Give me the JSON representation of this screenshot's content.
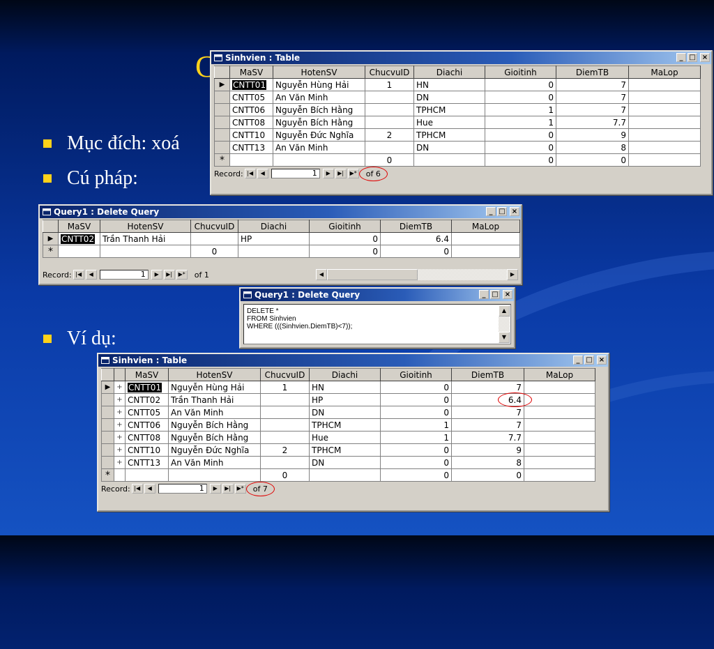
{
  "slide": {
    "title_fragment": "C",
    "bullets": [
      {
        "text": "Mục đích: xoá"
      },
      {
        "text": "Cú pháp:"
      },
      {
        "text": "Ví dụ:"
      }
    ],
    "accent_color": "#ffd21a"
  },
  "window1": {
    "title": "Sinhvien : Table",
    "columns": [
      "MaSV",
      "HotenSV",
      "ChucvuID",
      "Diachi",
      "Gioitinh",
      "DiemTB",
      "MaLop"
    ],
    "rows": [
      [
        "CNTT01",
        "Nguyễn Hùng Hải",
        "1",
        "HN",
        "0",
        "7",
        ""
      ],
      [
        "CNTT05",
        "An Văn Minh",
        "",
        "DN",
        "0",
        "7",
        ""
      ],
      [
        "CNTT06",
        "Nguyễn Bích Hằng",
        "",
        "TPHCM",
        "1",
        "7",
        ""
      ],
      [
        "CNTT08",
        "Nguyễn Bích Hằng",
        "",
        "Hue",
        "1",
        "7.7",
        ""
      ],
      [
        "CNTT10",
        "Nguyễn Đức Nghĩa",
        "2",
        "TPHCM",
        "0",
        "9",
        ""
      ],
      [
        "CNTT13",
        "An Văn Minh",
        "",
        "DN",
        "0",
        "8",
        ""
      ]
    ],
    "new_row": [
      "",
      "",
      "0",
      "",
      "0",
      "0",
      ""
    ],
    "nav": {
      "label": "Record:",
      "current": "1",
      "total": "of 6"
    }
  },
  "window2": {
    "title": "Query1 : Delete Query",
    "columns": [
      "MaSV",
      "HotenSV",
      "ChucvuID",
      "Diachi",
      "Gioitinh",
      "DiemTB",
      "MaLop"
    ],
    "rows": [
      [
        "CNTT02",
        "Trần Thanh Hải",
        "",
        "HP",
        "0",
        "6.4",
        ""
      ]
    ],
    "new_row": [
      "",
      "",
      "0",
      "",
      "0",
      "0",
      ""
    ],
    "nav": {
      "label": "Record:",
      "current": "1",
      "total": "of 1"
    }
  },
  "window3": {
    "title": "Query1 : Delete Query",
    "sql": "DELETE *\nFROM Sinhvien\nWHERE (((Sinhvien.DiemTB)<7));"
  },
  "window4": {
    "title": "Sinhvien : Table",
    "columns": [
      "MaSV",
      "HotenSV",
      "ChucvuID",
      "Diachi",
      "Gioitinh",
      "DiemTB",
      "MaLop"
    ],
    "rows": [
      [
        "CNTT01",
        "Nguyễn Hùng Hải",
        "1",
        "HN",
        "0",
        "7",
        ""
      ],
      [
        "CNTT02",
        "Trần Thanh Hải",
        "",
        "HP",
        "0",
        "6.4",
        ""
      ],
      [
        "CNTT05",
        "An Văn Minh",
        "",
        "DN",
        "0",
        "7",
        ""
      ],
      [
        "CNTT06",
        "Nguyễn Bích Hằng",
        "",
        "TPHCM",
        "1",
        "7",
        ""
      ],
      [
        "CNTT08",
        "Nguyễn Bích Hằng",
        "",
        "Hue",
        "1",
        "7.7",
        ""
      ],
      [
        "CNTT10",
        "Nguyễn Đức Nghĩa",
        "2",
        "TPHCM",
        "0",
        "9",
        ""
      ],
      [
        "CNTT13",
        "An Văn Minh",
        "",
        "DN",
        "0",
        "8",
        ""
      ]
    ],
    "new_row": [
      "",
      "",
      "0",
      "",
      "0",
      "0",
      ""
    ],
    "nav": {
      "label": "Record:",
      "current": "1",
      "total": "of 7"
    }
  },
  "icons": {
    "minimize": "_",
    "maximize": "□",
    "close": "×",
    "first": "|◀",
    "prev": "◀",
    "next": "▶",
    "last": "▶|",
    "new": "▶*",
    "current_row": "▶",
    "new_row_marker": "*",
    "expand": "+",
    "scroll_up": "▲",
    "scroll_down": "▼",
    "scroll_left": "◀",
    "scroll_right": "▶"
  }
}
